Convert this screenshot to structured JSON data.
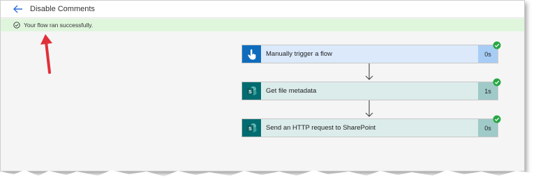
{
  "header": {
    "title": "Disable Comments",
    "back_icon": "back-arrow-icon"
  },
  "banner": {
    "message": "Your flow ran successfully.",
    "icon": "check-circle-icon"
  },
  "steps": [
    {
      "label": "Manually trigger a flow",
      "duration": "0s",
      "icon": "hand-tap-icon",
      "color": "#0f6cbd",
      "bg": "#dbe9fb",
      "dur_bg": "#a8cdf5"
    },
    {
      "label": "Get file metadata",
      "duration": "1s",
      "icon": "sharepoint-icon",
      "color": "#036c70",
      "bg": "#dbeceb",
      "dur_bg": "#9fcac8"
    },
    {
      "label": "Send an HTTP request to SharePoint",
      "duration": "0s",
      "icon": "sharepoint-icon",
      "color": "#036c70",
      "bg": "#dbeceb",
      "dur_bg": "#9fcac8"
    }
  ],
  "colors": {
    "success": "#27a744",
    "annotation": "#e0303a"
  }
}
